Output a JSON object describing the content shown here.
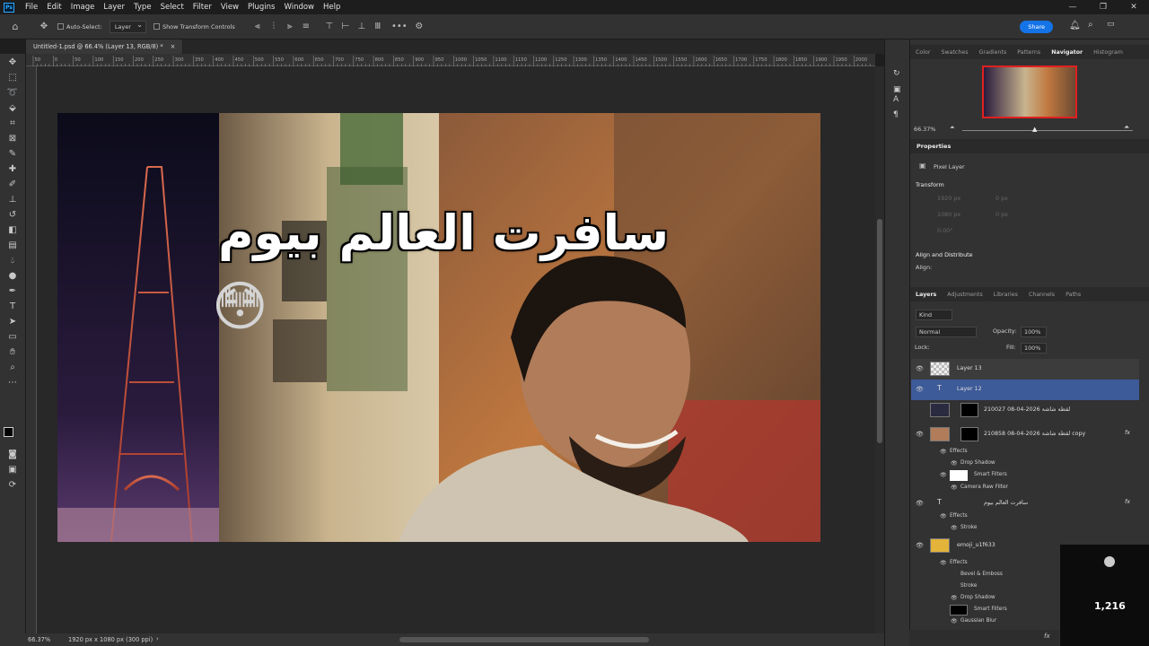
{
  "app": {
    "logo": "Ps",
    "menu": [
      "File",
      "Edit",
      "Image",
      "Layer",
      "Type",
      "Select",
      "Filter",
      "View",
      "Plugins",
      "Window",
      "Help"
    ],
    "share_label": "Share"
  },
  "options": {
    "auto_select_label": "Auto-Select:",
    "auto_select_value": "Layer",
    "transform_label": "Show Transform Controls"
  },
  "document": {
    "tab_title": "Untitled-1.psd @ 66.4% (Layer 13, RGB/8) *",
    "close": "×",
    "zoom": "66.37%",
    "info": "1920 px x 1080 px (300 ppi)",
    "headline": "سافرت العالم بيوم",
    "emoji": "😳"
  },
  "rulers": {
    "ticks": [
      "50",
      "0",
      "50",
      "100",
      "150",
      "200",
      "250",
      "300",
      "350",
      "400",
      "450",
      "500",
      "550",
      "600",
      "650",
      "700",
      "750",
      "800",
      "850",
      "900",
      "950",
      "1000",
      "1050",
      "1100",
      "1150",
      "1200",
      "1250",
      "1300",
      "1350",
      "1400",
      "1450",
      "1500",
      "1550",
      "1600",
      "1650",
      "1700",
      "1750",
      "1800",
      "1850",
      "1900",
      "1950",
      "2000"
    ]
  },
  "navigator": {
    "tabs": [
      "Color",
      "Swatches",
      "Gradients",
      "Patterns",
      "Navigator",
      "Histogram"
    ],
    "active": "Navigator",
    "zoom": "66.37%"
  },
  "properties": {
    "title": "Properties",
    "type": "Pixel Layer",
    "transform_label": "Transform",
    "w": "1920 px",
    "h": "1080 px",
    "x": "0 px",
    "y": "0 px",
    "angle": "0.00°",
    "align_label": "Align and Distribute",
    "align_sub": "Align:"
  },
  "layers": {
    "tabs": [
      "Layers",
      "Adjustments",
      "Libraries",
      "Channels",
      "Paths"
    ],
    "active": "Layers",
    "filter": "Kind",
    "blend": "Normal",
    "opacity_label": "Opacity:",
    "opacity": "100%",
    "lock_label": "Lock:",
    "fill_label": "Fill:",
    "fill": "100%",
    "items": [
      {
        "name": "Layer 13"
      },
      {
        "name": "Layer 12"
      },
      {
        "name": "لقطة شاشة 2026-04-08 210027"
      },
      {
        "name": "لقطة شاشة 2026-04-08 210858 copy"
      },
      {
        "name": "سافرت العالم بيوم"
      },
      {
        "name": "emoji_u1f633"
      }
    ],
    "sub": {
      "effects": "Effects",
      "drop_shadow": "Drop Shadow",
      "smart_filters": "Smart Filters",
      "camera_raw": "Camera Raw Filter",
      "stroke": "Stroke",
      "bevel": "Bevel & Emboss",
      "gaussian": "Gaussian Blur"
    },
    "fx": "fx"
  },
  "overlay": {
    "count": "1,216"
  },
  "colors": {
    "accent": "#1473e6",
    "selected_layer": "#3d5a99"
  }
}
